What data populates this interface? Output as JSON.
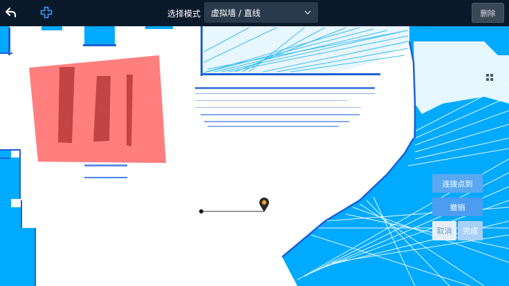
{
  "toolbar": {
    "back_icon": "back-arrow-icon",
    "move_icon": "move-cross-icon",
    "mode_label": "选择模式",
    "mode_value": "虚拟墙 / 直线",
    "delete_label": "删除"
  },
  "side_panel": {
    "connect_label": "连接点到",
    "undo_label": "撤销",
    "cancel_label": "取消",
    "done_label": "完成",
    "grid_icon": "grid-icon"
  },
  "map": {
    "forbidden_zone_color": "#ff7f7f",
    "obstacle_color": "#c24444",
    "scan_color": "#00aaff",
    "wall_point_color": "#1e5fd6",
    "marker_color": "#f0a030"
  }
}
